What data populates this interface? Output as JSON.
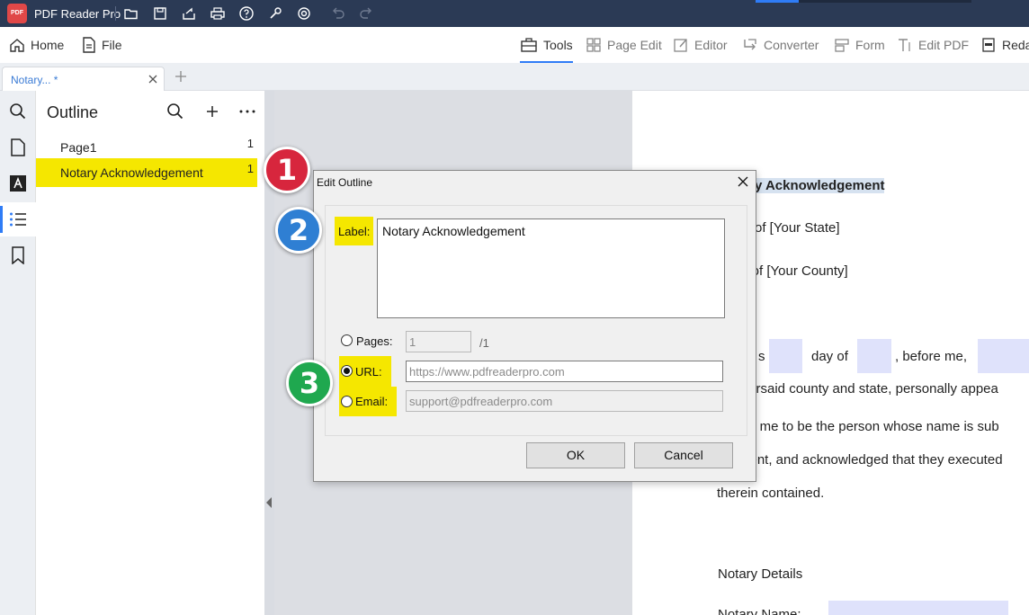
{
  "app": {
    "name": "PDF Reader Pro",
    "logo_text": "PDF"
  },
  "toolbar": {
    "home": "Home",
    "file": "File",
    "tools": "Tools",
    "page_edit": "Page Edit",
    "editor": "Editor",
    "converter": "Converter",
    "form": "Form",
    "edit_pdf": "Edit PDF",
    "redact": "Reda"
  },
  "tab": {
    "label": "Notary... *"
  },
  "outline": {
    "title": "Outline",
    "items": [
      {
        "label": "Page1",
        "page": "1"
      },
      {
        "label": "Notary Acknowledgement",
        "page": "1"
      }
    ]
  },
  "document": {
    "heading": "y Acknowledgement",
    "state": "of [Your State]",
    "county": "y of [Your County]",
    "line1a": "s",
    "line1b": "day of",
    "line1c": ", before me,",
    "line2": "forsaid county and state, personally appea",
    "line3": "to me to be the person whose name is sub",
    "line4": "ment, and acknowledged that they executed",
    "line5": "therein contained.",
    "details": "Notary Details",
    "notary_name": "Notary Name:"
  },
  "dialog": {
    "title": "Edit Outline",
    "label_caption": "Label:",
    "label_value": "Notary Acknowledgement",
    "pages_caption": "Pages:",
    "pages_value": "1",
    "pages_total": "/1",
    "url_caption": "URL:",
    "url_placeholder": "https://www.pdfreaderpro.com",
    "email_caption": "Email:",
    "email_placeholder": "support@pdfreaderpro.com",
    "ok": "OK",
    "cancel": "Cancel"
  },
  "callouts": [
    {
      "number": "1",
      "color": "#d7263d"
    },
    {
      "number": "2",
      "color": "#2f7fd3"
    },
    {
      "number": "3",
      "color": "#1fa84f"
    }
  ],
  "colors": {
    "titlebar": "#2b3a55",
    "accent": "#2f7cf6",
    "highlight": "#f5e700"
  }
}
